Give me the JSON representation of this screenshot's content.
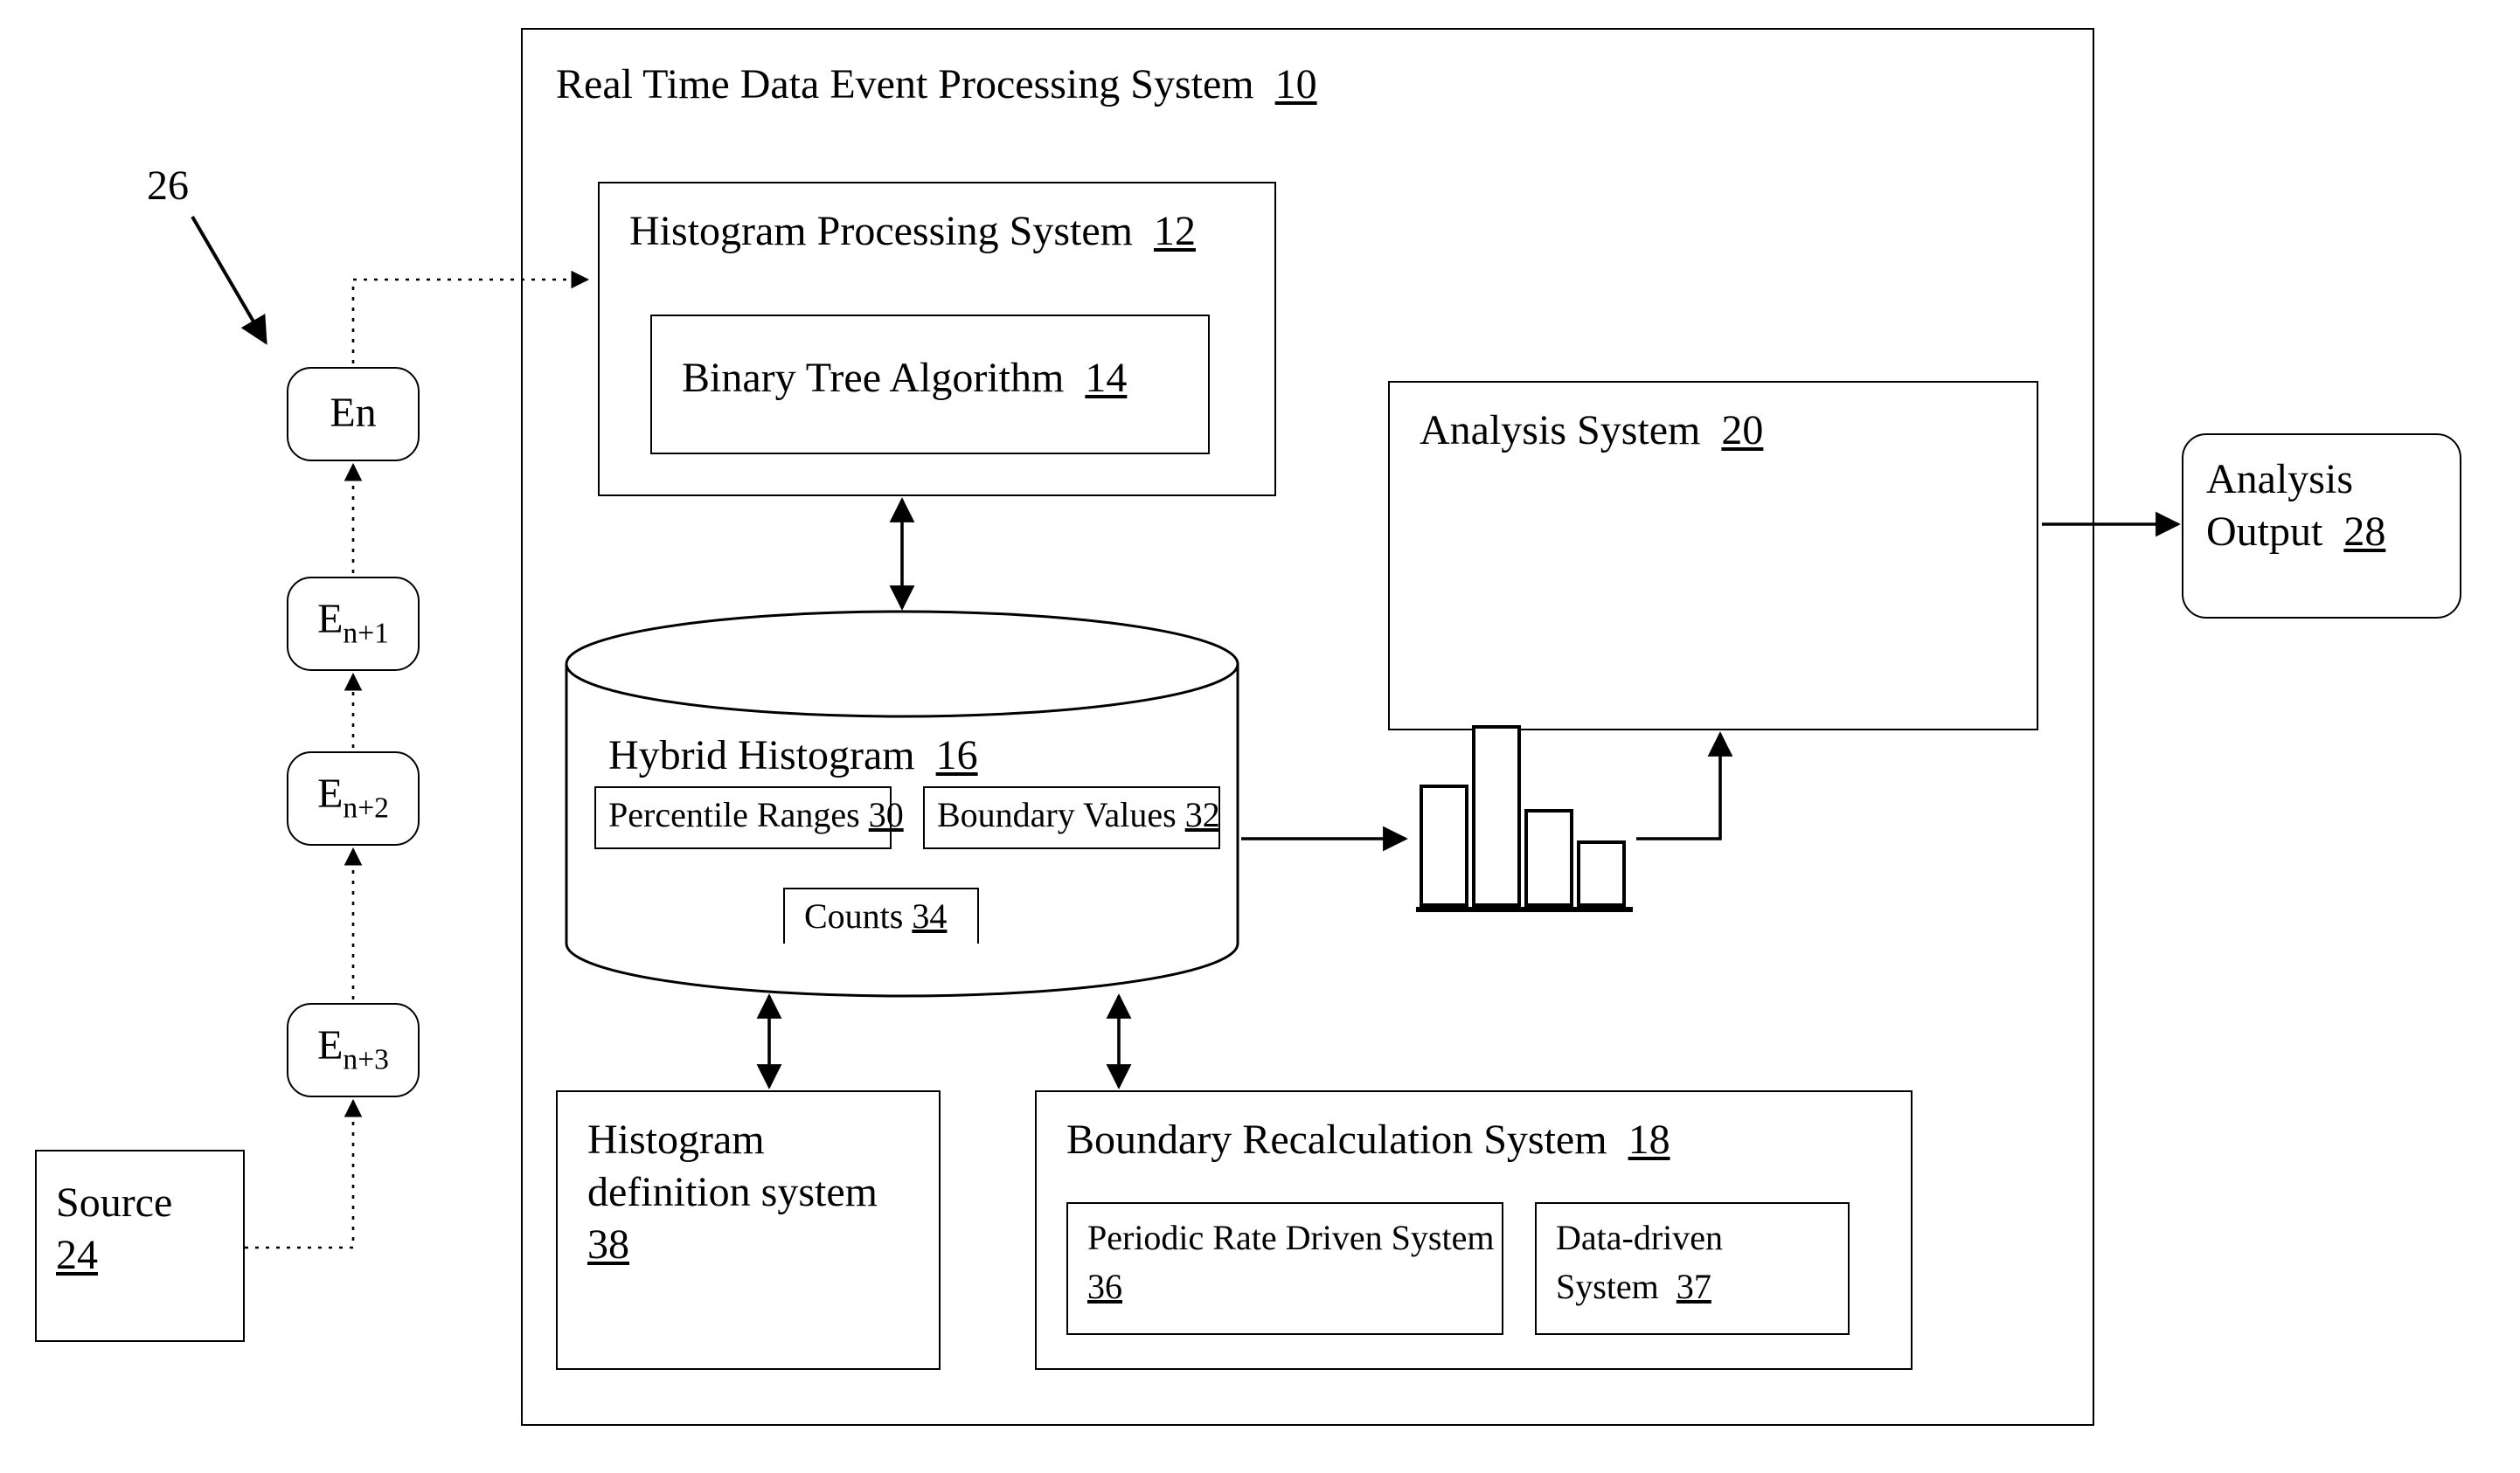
{
  "labels": {
    "ref26": "26",
    "source": {
      "text": "Source",
      "num": "24"
    },
    "events": {
      "en": "En",
      "en1_prefix": "E",
      "en1_sub": "n+1",
      "en2_prefix": "E",
      "en2_sub": "n+2",
      "en3_prefix": "E",
      "en3_sub": "n+3"
    },
    "main": {
      "text": "Real Time Data Event Processing System",
      "num": "10"
    },
    "hps": {
      "text": "Histogram Processing System",
      "num": "12"
    },
    "bta": {
      "text": "Binary Tree Algorithm",
      "num": "14"
    },
    "cyl": {
      "text": "Hybrid Histogram",
      "num": "16"
    },
    "pr": {
      "text": "Percentile Ranges",
      "num": "30"
    },
    "bv": {
      "text": "Boundary Values",
      "num": "32"
    },
    "cnt": {
      "text": "Counts",
      "num": "34"
    },
    "hdef": {
      "text_l1": "Histogram",
      "text_l2": "definition system",
      "num": "38"
    },
    "brs": {
      "text": "Boundary Recalculation System",
      "num": "18"
    },
    "prd": {
      "text_l1": "Periodic Rate Driven System",
      "num": "36"
    },
    "dds": {
      "text_l1": "Data-driven",
      "text_l2": "System",
      "num": "37"
    },
    "anls": {
      "text": "Analysis System",
      "num": "20"
    },
    "aout": {
      "text_l1": "Analysis",
      "text_l2": "Output",
      "num": "28"
    }
  }
}
